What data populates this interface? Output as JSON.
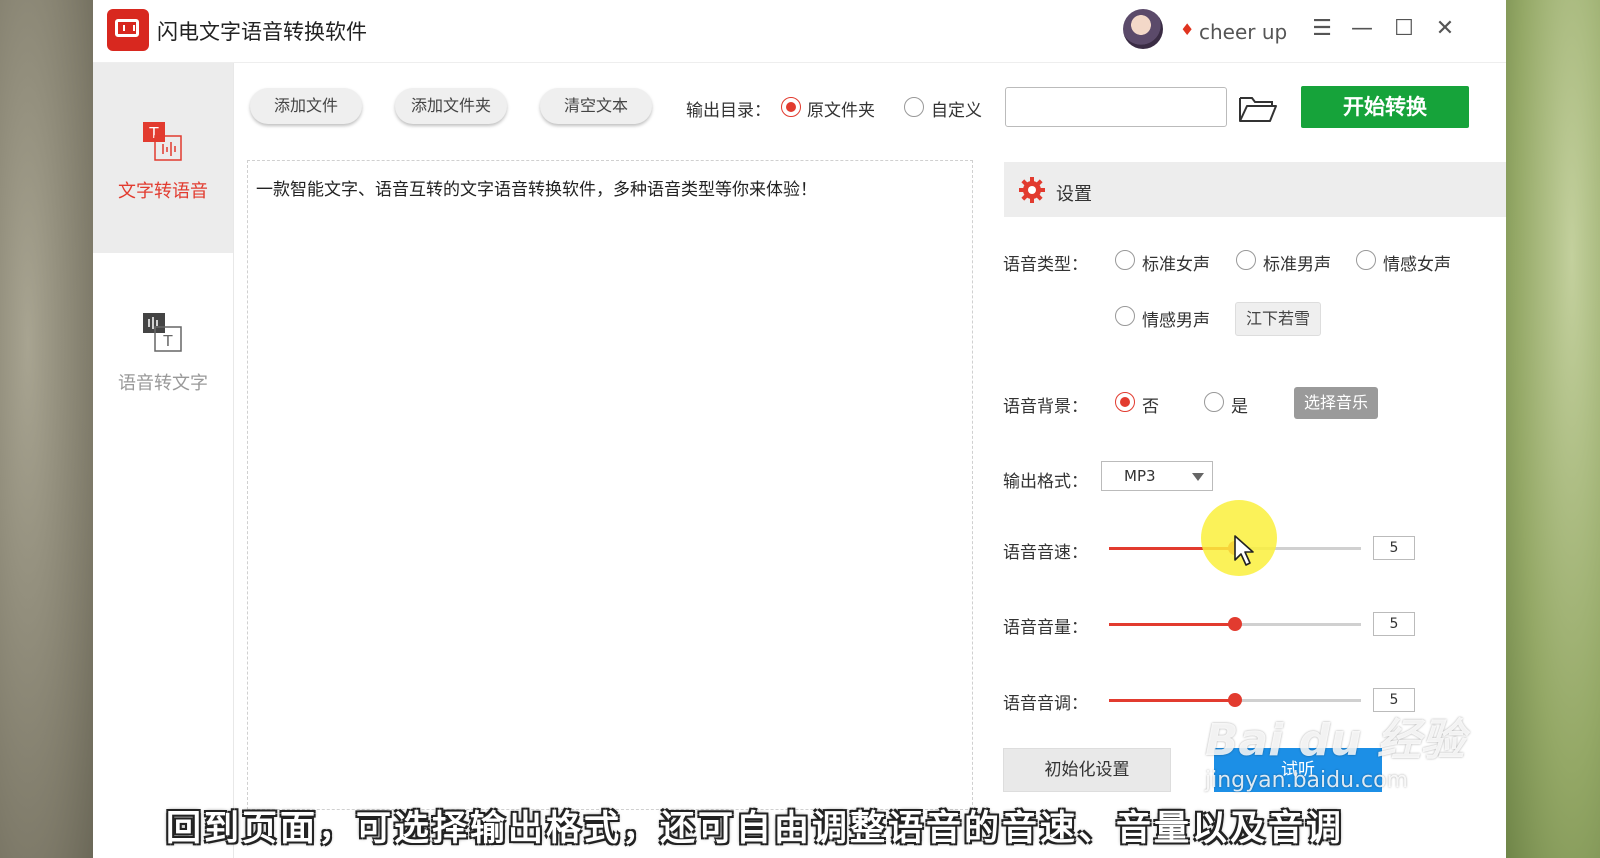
{
  "app": {
    "title": "闪电文字语音转换软件",
    "username": "cheer up"
  },
  "window_controls": {
    "menu": "☰",
    "minimize": "—",
    "maximize": "☐",
    "close": "✕"
  },
  "sidebar": {
    "items": [
      {
        "label": "文字转语音",
        "icon": "text-to-speech-icon",
        "active": true
      },
      {
        "label": "语音转文字",
        "icon": "speech-to-text-icon",
        "active": false
      }
    ]
  },
  "toolbar": {
    "add_file": "添加文件",
    "add_folder": "添加文件夹",
    "clear_text": "清空文本",
    "output_dir_label": "输出目录：",
    "output_options": [
      "原文件夹",
      "自定义"
    ],
    "output_selected": "原文件夹",
    "path_value": "",
    "start_label": "开始转换"
  },
  "editor": {
    "text": "一款智能文字、语音互转的文字语音转换软件，多种语音类型等你来体验！"
  },
  "settings": {
    "title": "设置",
    "voice_type_label": "语音类型：",
    "voice_types": [
      "标准女声",
      "标准男声",
      "情感女声",
      "情感男声"
    ],
    "voice_chip": "江下若雪",
    "bg_label": "语音背景：",
    "bg_options": [
      "否",
      "是"
    ],
    "bg_selected": "否",
    "choose_music": "选择音乐",
    "format_label": "输出格式：",
    "format_value": "MP3",
    "speed_label": "语音音速：",
    "speed_value": "5",
    "speed_fraction": 0.5,
    "volume_label": "语音音量：",
    "volume_value": "5",
    "volume_fraction": 0.5,
    "pitch_label": "语音音调：",
    "pitch_value": "5",
    "pitch_fraction": 0.5,
    "reset_label": "初始化设置",
    "listen_label": "试听"
  },
  "watermark": {
    "main": "Bai du 经验",
    "sub": "jingyan.baidu.com"
  },
  "subtitle": "回到页面，可选择输出格式，还可自由调整语音的音速、音量以及音调",
  "colors": {
    "accent": "#e23b2f",
    "start_green": "#16a33a",
    "listen_blue": "#1c8fe6"
  }
}
